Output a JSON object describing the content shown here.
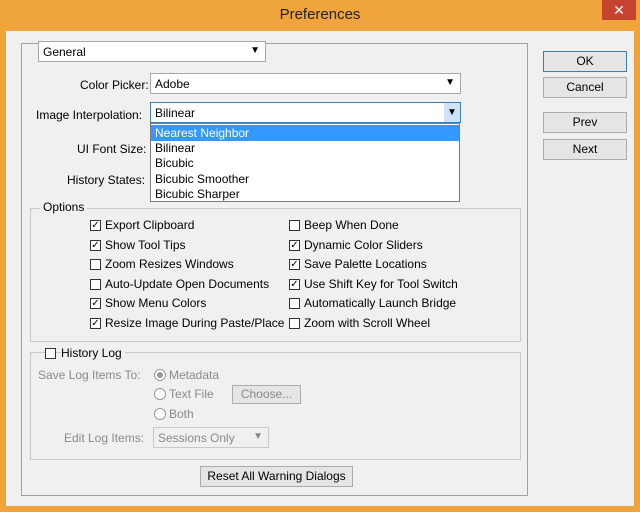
{
  "window": {
    "title": "Preferences",
    "close_glyph": "✕"
  },
  "section": {
    "selected": "General"
  },
  "fields": {
    "color_picker_label": "Color Picker:",
    "color_picker_value": "Adobe",
    "image_interp_label": "Image Interpolation:",
    "image_interp_value": "Bilinear",
    "ui_font_size_label": "UI Font Size:",
    "history_states_label": "History States:"
  },
  "interp_options": [
    "Nearest Neighbor",
    "Bilinear",
    "Bicubic",
    "Bicubic Smoother",
    "Bicubic Sharper"
  ],
  "options": {
    "legend": "Options",
    "left": [
      {
        "label": "Export Clipboard",
        "checked": true
      },
      {
        "label": "Show Tool Tips",
        "checked": true
      },
      {
        "label": "Zoom Resizes Windows",
        "checked": false
      },
      {
        "label": "Auto-Update Open Documents",
        "checked": false
      },
      {
        "label": "Show Menu Colors",
        "checked": true
      },
      {
        "label": "Resize Image During Paste/Place",
        "checked": true
      }
    ],
    "right": [
      {
        "label": "Beep When Done",
        "checked": false
      },
      {
        "label": "Dynamic Color Sliders",
        "checked": true
      },
      {
        "label": "Save Palette Locations",
        "checked": true
      },
      {
        "label": "Use Shift Key for Tool Switch",
        "checked": true
      },
      {
        "label": "Automatically Launch Bridge",
        "checked": false
      },
      {
        "label": "Zoom with Scroll Wheel",
        "checked": false
      }
    ]
  },
  "history": {
    "legend": "History Log",
    "save_to_label": "Save Log Items To:",
    "radio_metadata": "Metadata",
    "radio_textfile": "Text File",
    "radio_both": "Both",
    "choose_button": "Choose...",
    "edit_label": "Edit Log Items:",
    "edit_value": "Sessions Only"
  },
  "reset_button": "Reset All Warning Dialogs",
  "buttons": {
    "ok": "OK",
    "cancel": "Cancel",
    "prev": "Prev",
    "next": "Next"
  },
  "icons": {
    "check": "✓",
    "chevron": "⌄"
  }
}
